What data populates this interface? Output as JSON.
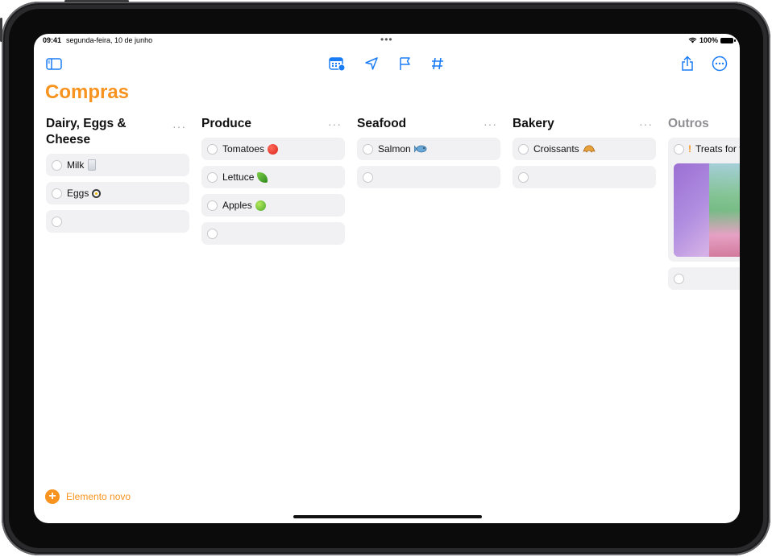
{
  "status": {
    "time": "09:41",
    "date": "segunda-feira, 10 de junho",
    "dots": "•••",
    "battery": "100%"
  },
  "title": "Compras",
  "columns": [
    {
      "name": "Dairy, Eggs & Cheese",
      "more": "···",
      "items": [
        {
          "text": "Milk",
          "emoji": "milk-glass"
        },
        {
          "text": "Eggs",
          "emoji": "fried-egg"
        },
        {
          "text": "",
          "emoji": ""
        }
      ]
    },
    {
      "name": "Produce",
      "more": "···",
      "items": [
        {
          "text": "Tomatoes",
          "emoji": "tomato"
        },
        {
          "text": "Lettuce",
          "emoji": "leafy-green"
        },
        {
          "text": "Apples",
          "emoji": "green-apple"
        },
        {
          "text": "",
          "emoji": ""
        }
      ]
    },
    {
      "name": "Seafood",
      "more": "···",
      "items": [
        {
          "text": "Salmon",
          "emoji": "fish"
        },
        {
          "text": "",
          "emoji": ""
        }
      ]
    },
    {
      "name": "Bakery",
      "more": "···",
      "items": [
        {
          "text": "Croissants",
          "emoji": "croissant"
        },
        {
          "text": "",
          "emoji": ""
        }
      ]
    },
    {
      "name": "Outros",
      "more": "",
      "items": [
        {
          "text": "Treats for t",
          "priority": "!"
        },
        {
          "text": "",
          "emoji": ""
        }
      ]
    }
  ],
  "new_item": "Elemento novo",
  "colors": {
    "accent": "#f7931e",
    "blue": "#1a7cf5",
    "item_bg": "#f1f1f4"
  }
}
